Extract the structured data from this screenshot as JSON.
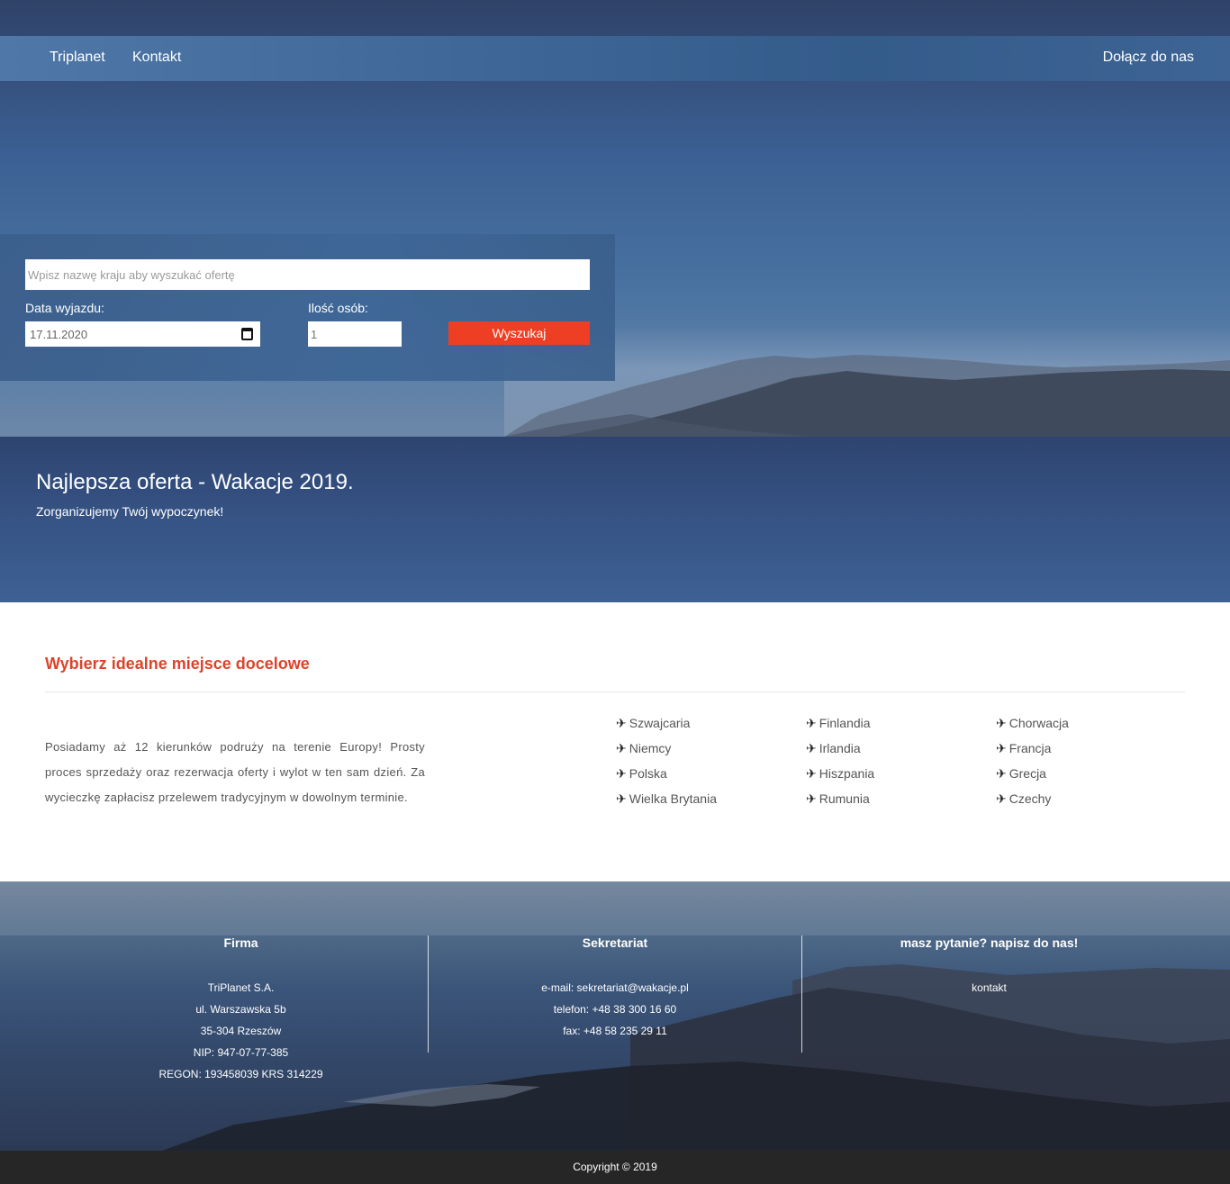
{
  "nav": {
    "brand": "Triplanet",
    "contact": "Kontakt",
    "join": "Dołącz do nas"
  },
  "search": {
    "placeholder": "Wpisz nazwę kraju aby wyszukać ofertę",
    "date_label": "Data wyjazdu:",
    "date_value": "17.11.2020",
    "people_label": "Ilość osób:",
    "people_placeholder": "1",
    "button": "Wyszukaj",
    "button_color": "#ee3f24"
  },
  "hero": {
    "title": "Najlepsza oferta - Wakacje 2019.",
    "subtitle": "Zorganizujemy Twój wypoczynek!"
  },
  "destinations": {
    "heading": "Wybierz idealne miejsce docelowe",
    "heading_color": "#e0412a",
    "text": "Posiadamy aż 12 kierunków podruży na terenie Europy! Prosty proces sprzedaży oraz rezerwacja oferty i wylot w ten sam dzień. Za wycieczkę zapłacisz przelewem tradycyjnym w dowolnym terminie.",
    "icon": "airplane-icon",
    "columns": [
      [
        "Szwajcaria",
        "Niemcy",
        "Polska",
        "Wielka Brytania"
      ],
      [
        "Finlandia",
        "Irlandia",
        "Hiszpania",
        "Rumunia"
      ],
      [
        "Chorwacja",
        "Francja",
        "Grecja",
        "Czechy"
      ]
    ]
  },
  "footer": {
    "company": {
      "heading": "Firma",
      "lines": [
        "TriPlanet S.A.",
        "ul. Warszawska 5b",
        "35-304 Rzeszów",
        "NIP: 947-07-77-385",
        "REGON: 193458039 KRS 314229"
      ]
    },
    "secretariat": {
      "heading": "Sekretariat",
      "lines": [
        "e-mail: sekretariat@wakacje.pl",
        "telefon: +48 38 300 16 60",
        "fax: +48 58 235 29 11"
      ]
    },
    "question": {
      "heading": "masz pytanie? napisz do nas!",
      "link": "kontakt"
    },
    "copyright": "Copyright © 2019"
  }
}
